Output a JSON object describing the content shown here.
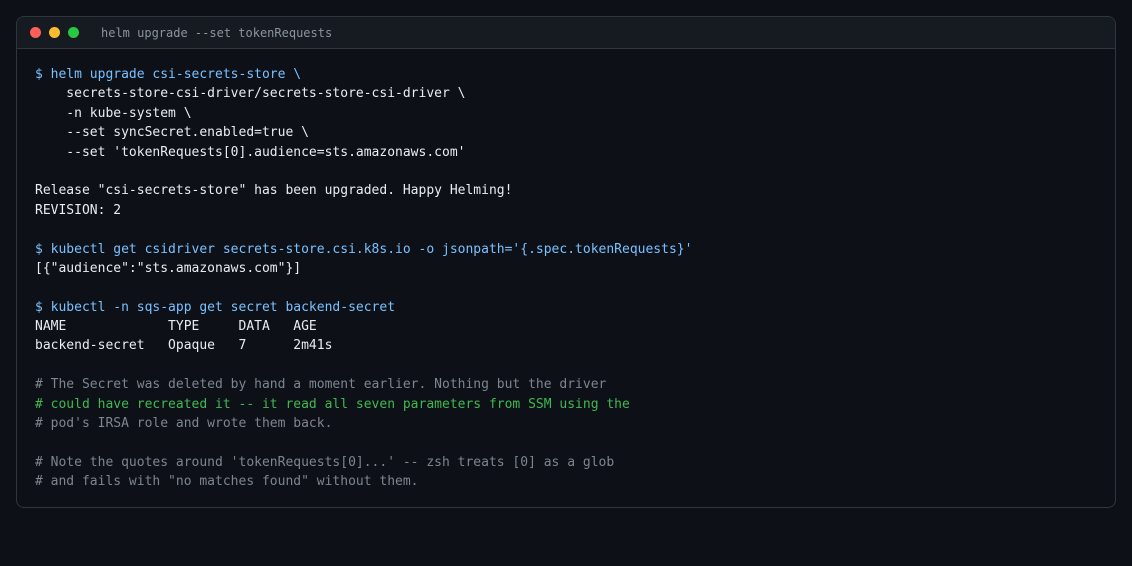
{
  "window": {
    "title": "helm upgrade --set tokenRequests",
    "controls": [
      {
        "name": "close",
        "color": "#ff5f57"
      },
      {
        "name": "minimize",
        "color": "#febc2e"
      },
      {
        "name": "maximize",
        "color": "#28c840"
      }
    ]
  },
  "terminal": {
    "lines": [
      {
        "kind": "cmd",
        "text": "$ helm upgrade csi-secrets-store \\"
      },
      {
        "kind": "cmd-cont",
        "text": "    secrets-store-csi-driver/secrets-store-csi-driver \\"
      },
      {
        "kind": "cmd-cont",
        "text": "    -n kube-system \\"
      },
      {
        "kind": "cmd-cont",
        "text": "    --set syncSecret.enabled=true \\"
      },
      {
        "kind": "cmd-cont",
        "text": "    --set 'tokenRequests[0].audience=sts.amazonaws.com'"
      },
      {
        "kind": "blank",
        "text": ""
      },
      {
        "kind": "out",
        "text": "Release \"csi-secrets-store\" has been upgraded. Happy Helming!"
      },
      {
        "kind": "out",
        "text": "REVISION: 2"
      },
      {
        "kind": "blank",
        "text": ""
      },
      {
        "kind": "cmd",
        "text": "$ kubectl get csidriver secrets-store.csi.k8s.io -o jsonpath='{.spec.tokenRequests}'"
      },
      {
        "kind": "out",
        "text": "[{\"audience\":\"sts.amazonaws.com\"}]"
      },
      {
        "kind": "blank",
        "text": ""
      },
      {
        "kind": "cmd",
        "text": "$ kubectl -n sqs-app get secret backend-secret"
      },
      {
        "kind": "out",
        "text": "NAME             TYPE     DATA   AGE"
      },
      {
        "kind": "out",
        "text": "backend-secret   Opaque   7      2m41s"
      },
      {
        "kind": "blank",
        "text": ""
      },
      {
        "kind": "comment",
        "text": "# The Secret was deleted by hand a moment earlier. Nothing but the driver"
      },
      {
        "kind": "highlight",
        "text": "# could have recreated it -- it read all seven parameters from SSM using the"
      },
      {
        "kind": "comment",
        "text": "# pod's IRSA role and wrote them back."
      },
      {
        "kind": "blank",
        "text": ""
      },
      {
        "kind": "comment",
        "text": "# Note the quotes around 'tokenRequests[0]...' -- zsh treats [0] as a glob"
      },
      {
        "kind": "comment",
        "text": "# and fails with \"no matches found\" without them."
      }
    ]
  }
}
